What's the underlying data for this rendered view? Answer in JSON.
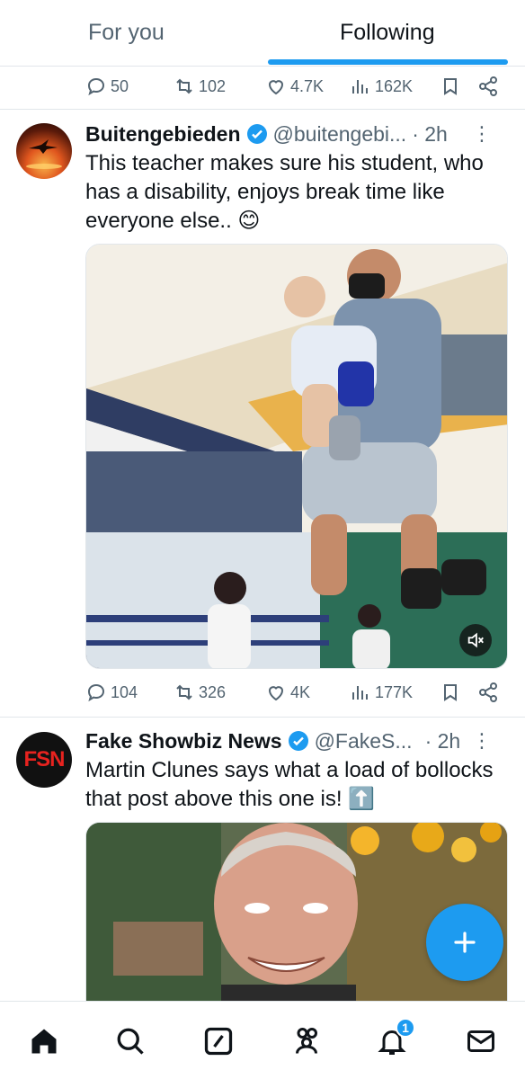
{
  "tabs": {
    "for_you": "For you",
    "following": "Following"
  },
  "top_actions": {
    "replies": "50",
    "reposts": "102",
    "likes": "4.7K",
    "views": "162K"
  },
  "tweet1": {
    "name": "Buitengebieden",
    "handle": "@buitengebi...",
    "time": "· 2h",
    "text": "This teacher makes sure his student, who has a disability, enjoys break time like everyone else.. 😊",
    "actions": {
      "replies": "104",
      "reposts": "326",
      "likes": "4K",
      "views": "177K"
    }
  },
  "tweet2": {
    "name": "Fake Showbiz News",
    "handle": "@FakeS...",
    "time": "· 2h",
    "avatar_text": "FSN",
    "text": "Martin Clunes says what a load of bollocks that post above this one is! ⬆️"
  },
  "nav": {
    "notifications_badge": "1"
  },
  "colors": {
    "accent": "#1d9bf0",
    "text": "#0f1419",
    "secondary": "#536471"
  }
}
